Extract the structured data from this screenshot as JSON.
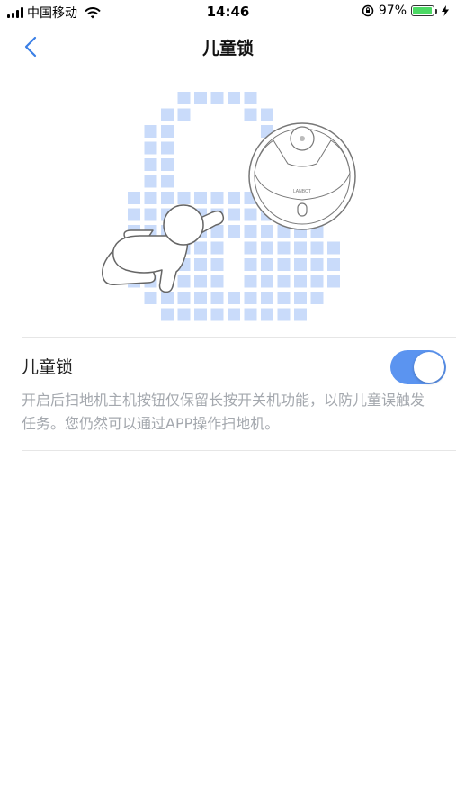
{
  "status_bar": {
    "carrier": "中国移动",
    "time": "14:46",
    "battery_percent": "97%",
    "battery_level": 0.97,
    "icons": [
      "signal-icon",
      "wifi-icon",
      "rotation-lock-icon",
      "battery-icon",
      "charging-icon"
    ]
  },
  "nav": {
    "title": "儿童锁",
    "back_icon": "chevron-left-icon"
  },
  "illustration": {
    "icons": [
      "pixel-lock-icon",
      "baby-crawling-icon",
      "robot-vacuum-icon"
    ],
    "robot_brand": "LANBOT"
  },
  "setting": {
    "title": "儿童锁",
    "toggle_on": true,
    "description": "开启后扫地机主机按钮仅保留长按开关机功能，以防儿童误触发任务。您仍然可以通过APP操作扫地机。"
  },
  "colors": {
    "accent": "#5b94f0",
    "tile": "#c9dbfa",
    "back_arrow": "#3a7fe6",
    "description": "#a4a8ae"
  }
}
